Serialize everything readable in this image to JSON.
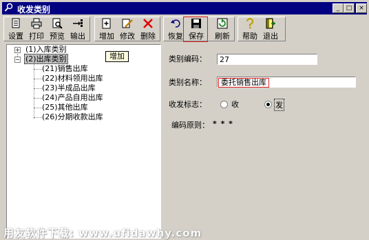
{
  "window": {
    "title": "收发类别",
    "controls": {
      "minimize": "_",
      "maximize": "□",
      "close": "×"
    }
  },
  "toolbar": {
    "buttons": [
      {
        "label": "设置",
        "icon": "settings-icon"
      },
      {
        "label": "打印",
        "icon": "print-icon"
      },
      {
        "label": "预览",
        "icon": "preview-icon"
      },
      {
        "label": "输出",
        "icon": "export-icon"
      },
      {
        "label": "增加",
        "icon": "add-icon"
      },
      {
        "label": "修改",
        "icon": "edit-icon"
      },
      {
        "label": "删除",
        "icon": "delete-icon"
      },
      {
        "label": "恢复",
        "icon": "undo-icon"
      },
      {
        "label": "保存",
        "icon": "save-icon"
      },
      {
        "label": "刷新",
        "icon": "refresh-icon"
      },
      {
        "label": "帮助",
        "icon": "help-icon"
      },
      {
        "label": "退出",
        "icon": "exit-icon"
      }
    ]
  },
  "tooltip": "增加",
  "tree": {
    "nodes": [
      {
        "label": "(1)入库类别",
        "expander": "+"
      },
      {
        "label": "(2)出库类别",
        "expander": "−"
      },
      {
        "label": "(21)销售出库"
      },
      {
        "label": "(22)材料领用出库"
      },
      {
        "label": "(23)半成品出库"
      },
      {
        "label": "(24)产品自用出库"
      },
      {
        "label": "(25)其他出库"
      },
      {
        "label": "(26)分期收款出库"
      }
    ]
  },
  "form": {
    "code_label": "类别编码：",
    "code_value": "27",
    "name_label": "类别名称：",
    "name_value": "委托销售出库",
    "flag_label": "收发标志：",
    "flag_options": {
      "receive": "收",
      "issue": "发"
    },
    "flag_selected": "发",
    "rule_label": "编码原则：",
    "rule_value": "* * *"
  },
  "watermark": "用友软件下载: www.ufidawhy.com"
}
